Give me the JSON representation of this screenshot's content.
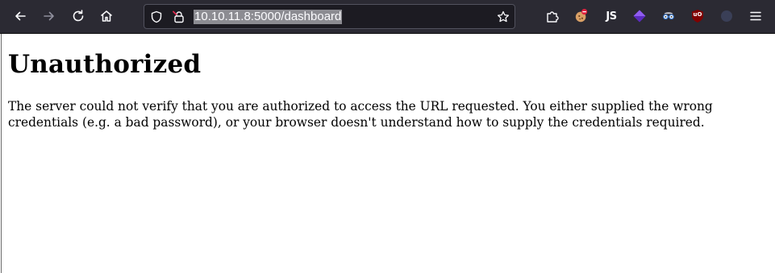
{
  "browser": {
    "url": "10.10.11.8:5000/dashboard",
    "nav_icons": [
      "back-arrow-icon",
      "forward-arrow-icon",
      "reload-icon",
      "home-icon"
    ],
    "url_icons": [
      "shield-icon",
      "insecure-lock-icon",
      "star-bookmark-icon"
    ],
    "extensions": [
      "extensions-puzzle-icon",
      "cookie-extension-icon",
      "js-extension-icon",
      "purple-diamond-extension-icon",
      "spy-glasses-extension-icon",
      "ublock-origin-icon",
      "container-extension-icon",
      "menu-icon"
    ],
    "ext_js_label": "JS",
    "ext_ublock_label": "uO"
  },
  "page": {
    "heading": "Unauthorized",
    "message": "The server could not verify that you are authorized to access the URL requested. You either supplied the wrong credentials (e.g. a bad password), or your browser doesn't understand how to supply the credentials required."
  },
  "colors": {
    "toolbar_bg": "#2b2a33",
    "urlbar_bg": "#1c1b22",
    "url_selection": "#8c8c92",
    "icon_color": "#fbfbfe",
    "ublock_red": "#800000"
  }
}
